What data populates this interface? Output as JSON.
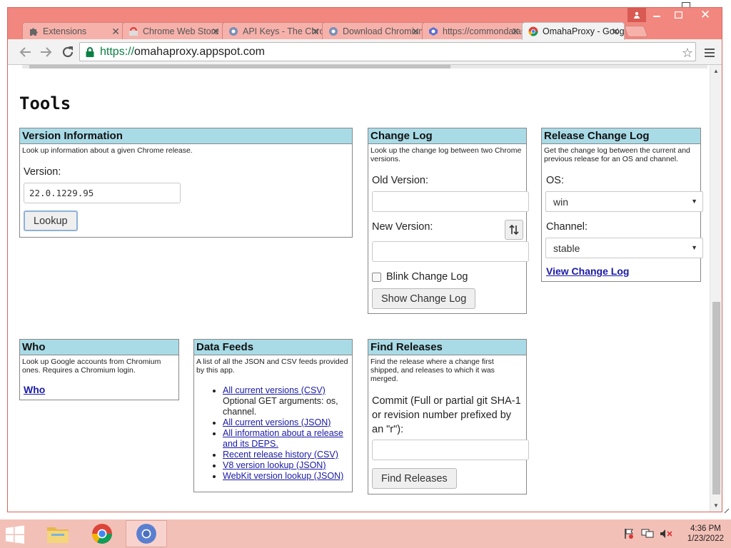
{
  "browser": {
    "tabs": [
      {
        "title": "Extensions",
        "icon": "puzzle-icon"
      },
      {
        "title": "Chrome Web Store",
        "icon": "webstore-icon"
      },
      {
        "title": "API Keys - The Chromium Projects",
        "icon": "chromium-icon"
      },
      {
        "title": "Download Chromium",
        "icon": "chromium-icon"
      },
      {
        "title": "https://commondatastorage",
        "icon": "storage-icon"
      },
      {
        "title": "OmahaProxy - Google Chrome",
        "icon": "chrome-icon",
        "active": true
      }
    ],
    "url_scheme": "https://",
    "url_host": "omahaproxy.appspot.com"
  },
  "page": {
    "title": "Tools",
    "version_info": {
      "heading": "Version Information",
      "desc": "Look up information about a given Chrome release.",
      "version_label": "Version:",
      "version_value": "22.0.1229.95",
      "lookup_button": "Lookup"
    },
    "change_log": {
      "heading": "Change Log",
      "desc": "Look up the change log between two Chrome versions.",
      "old_label": "Old Version:",
      "new_label": "New Version:",
      "blink_label": "Blink Change Log",
      "show_button": "Show Change Log"
    },
    "release_change_log": {
      "heading": "Release Change Log",
      "desc": "Get the change log between the current and previous release for an OS and channel.",
      "os_label": "OS:",
      "os_value": "win",
      "channel_label": "Channel:",
      "channel_value": "stable",
      "view_link": "View Change Log"
    },
    "who": {
      "heading": "Who",
      "desc": "Look up Google accounts from Chromium ones. Requires a Chromium login.",
      "link": "Who"
    },
    "data_feeds": {
      "heading": "Data Feeds",
      "desc": "A list of all the JSON and CSV feeds provided by this app.",
      "items": [
        {
          "link": "All current versions (CSV)",
          "note": "Optional GET arguments: os, channel."
        },
        {
          "link": "All current versions (JSON)",
          "note": ""
        },
        {
          "link": "All information about a release and its DEPS.",
          "note": ""
        },
        {
          "link": "Recent release history (CSV)",
          "note": ""
        },
        {
          "link": "V8 version lookup (JSON)",
          "note": ""
        },
        {
          "link": "WebKit version lookup (JSON)",
          "note": ""
        }
      ]
    },
    "find_releases": {
      "heading": "Find Releases",
      "desc": "Find the release where a change first shipped, and releases to which it was merged.",
      "commit_label": "Commit (Full or partial git SHA-1 or revision number prefixed by an \"r\"):",
      "find_button": "Find Releases"
    }
  },
  "taskbar": {
    "time": "4:36 PM",
    "date": "1/23/2022"
  },
  "colors": {
    "window_frame": "#f1877e",
    "panel_header": "#a9dbe7",
    "link": "#1a1aa6"
  }
}
